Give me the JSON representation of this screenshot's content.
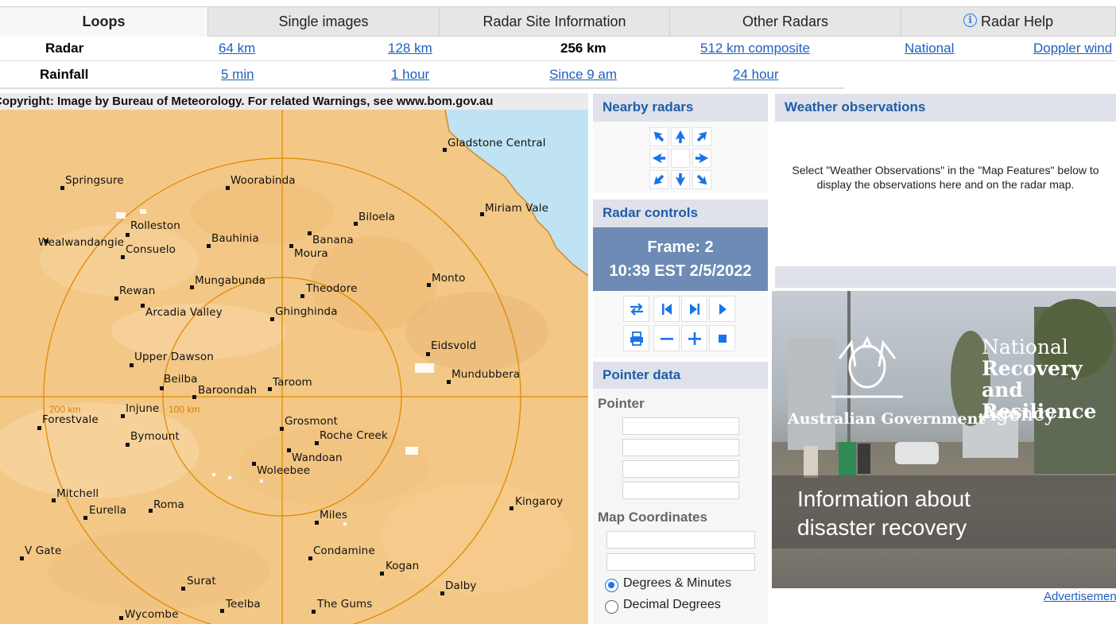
{
  "tabs": [
    {
      "label": "Loops",
      "active": true
    },
    {
      "label": "Single images"
    },
    {
      "label": "Radar Site Information"
    },
    {
      "label": "Other Radars"
    },
    {
      "label": "Radar Help",
      "icon": "info-icon"
    }
  ],
  "radar_row": {
    "label": "Radar",
    "links": [
      "64 km",
      "128 km",
      "256 km",
      "512 km composite",
      "National",
      "Doppler wind"
    ],
    "current": "256 km"
  },
  "rainfall_row": {
    "label": "Rainfall",
    "links": [
      "5 min",
      "1 hour",
      "Since 9 am",
      "24 hour"
    ]
  },
  "map": {
    "copyright": "Copyright: Image by Bureau of Meteorology. For related Warnings, see www.bom.gov.au",
    "range_labels": [
      "200 km",
      "100 km"
    ],
    "towns": [
      "Gladstone Central",
      "Springsure",
      "Woorabinda",
      "Miriam Vale",
      "Biloela",
      "Rolleston",
      "Wealwandangie",
      "Bauhinia",
      "Banana",
      "Consuelo",
      "Moura",
      "Mungabunda",
      "Monto",
      "Rewan",
      "Theodore",
      "Arcadia Valley",
      "Ghinghinda",
      "Eidsvold",
      "Upper Dawson",
      "Mundubbera",
      "Beilba",
      "Taroom",
      "Baroondah",
      "Injune",
      "Forestvale",
      "Grosmont",
      "Bymount",
      "Roche Creek",
      "Wandoan",
      "Woleebee",
      "Mitchell",
      "Kingaroy",
      "Eurella",
      "Roma",
      "Miles",
      "V Gate",
      "Condamine",
      "Kogan",
      "Surat",
      "Dalby",
      "Teelba",
      "The Gums",
      "Wycombe"
    ]
  },
  "nearby": {
    "title": "Nearby radars"
  },
  "controls": {
    "title": "Radar controls",
    "frame": "Frame: 2",
    "time": "10:39 EST 2/5/2022"
  },
  "pointer": {
    "title": "Pointer data",
    "pointer_label": "Pointer",
    "coords_label": "Map Coordinates",
    "options": [
      "Degrees & Minutes",
      "Decimal Degrees"
    ],
    "selected": "Degrees & Minutes"
  },
  "observations": {
    "title": "Weather observations",
    "text": "Select \"Weather Observations\" in the \"Map Features\" below to display the observations here and on the radar map."
  },
  "ad": {
    "gov": "Australian Government",
    "agency_line1": "National",
    "agency_line2": "Recovery and Resilience",
    "agency_line3": "Agency",
    "message": "Information about disaster recovery",
    "link": "Advertisement"
  },
  "colors": {
    "accent": "#1e5da8",
    "link": "#1f5fc1",
    "frame_bg": "#6d8bb5",
    "map_land": "#f3c886",
    "sea": "#bfe3f3",
    "range_ring": "#e08a00"
  }
}
